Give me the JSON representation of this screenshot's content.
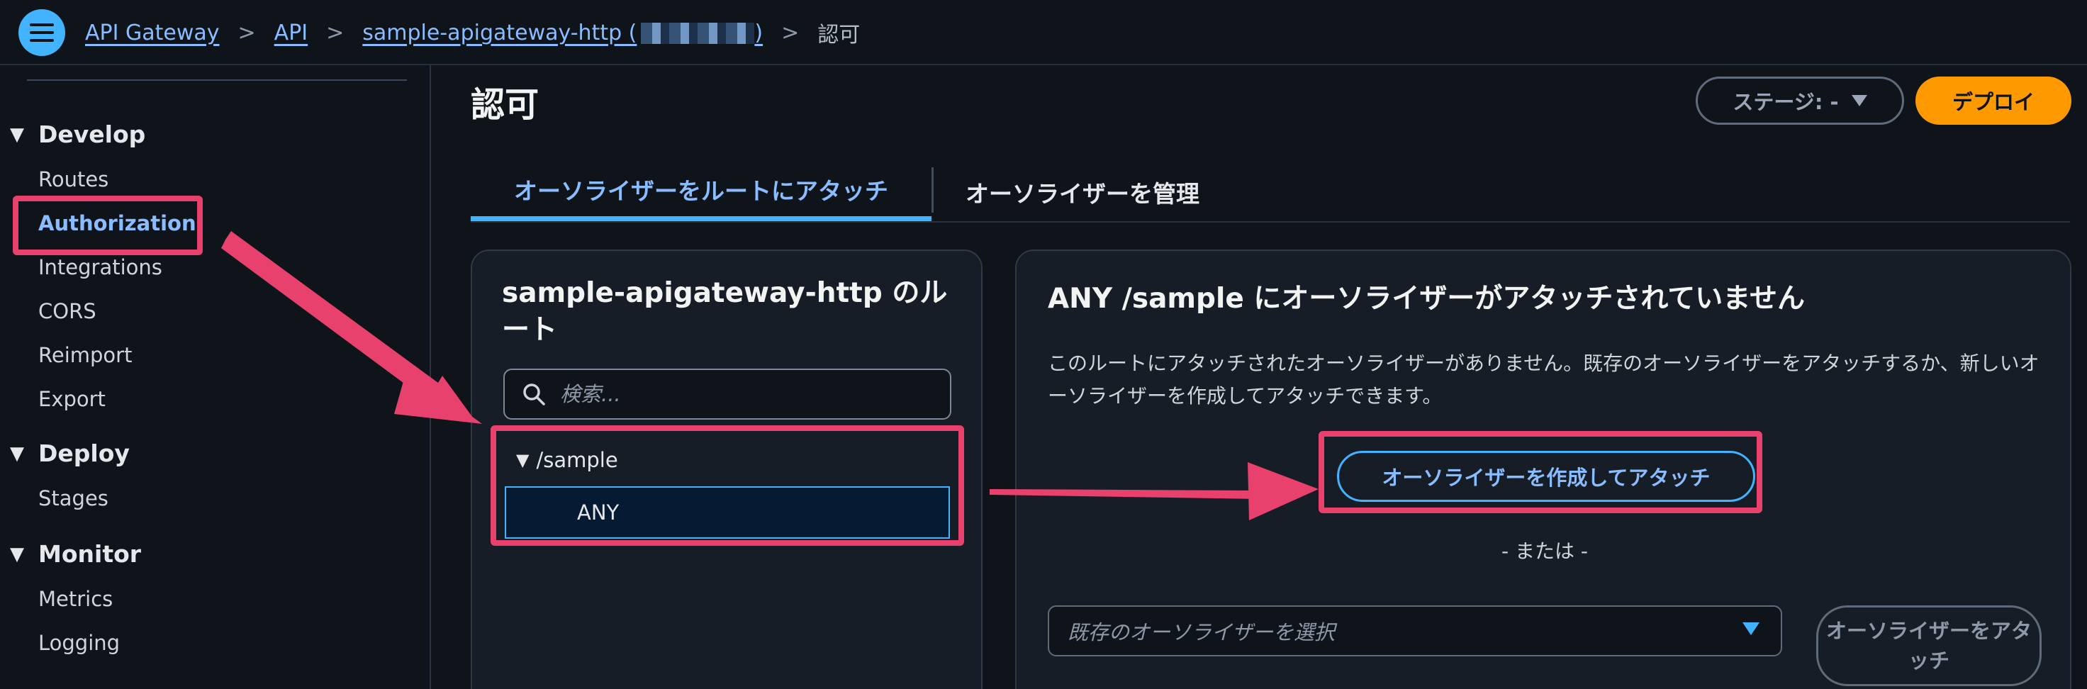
{
  "breadcrumb": {
    "items": [
      "API Gateway",
      "API",
      "sample-apigateway-http ("
    ],
    "tail": ")",
    "current": "認可"
  },
  "sidebar": {
    "sections": [
      {
        "label": "Develop",
        "items": [
          "Routes",
          "Authorization",
          "Integrations",
          "CORS",
          "Reimport",
          "Export"
        ]
      },
      {
        "label": "Deploy",
        "items": [
          "Stages"
        ]
      },
      {
        "label": "Monitor",
        "items": [
          "Metrics",
          "Logging"
        ]
      }
    ],
    "active_item": "Authorization"
  },
  "header": {
    "title": "認可",
    "stage_label": "ステージ: -",
    "deploy_label": "デプロイ"
  },
  "tabs": [
    {
      "label": "オーソライザーをルートにアタッチ",
      "active": true
    },
    {
      "label": "オーソライザーを管理",
      "active": false
    }
  ],
  "routes_panel": {
    "title": "sample-apigateway-http のルート",
    "search_placeholder": "検索...",
    "route_path": "/sample",
    "route_method": "ANY"
  },
  "detail_panel": {
    "title": "ANY /sample にオーソライザーがアタッチされていません",
    "description": "このルートにアタッチされたオーソライザーがありません。既存のオーソライザーをアタッチするか、新しいオーソライザーを作成してアタッチできます。",
    "create_button": "オーソライザーを作成してアタッチ",
    "or_text": "- または -",
    "select_placeholder": "既存のオーソライザーを選択",
    "attach_button": "オーソライザーをアタッチ"
  },
  "colors": {
    "accent": "#42b4ff",
    "link": "#89bdff",
    "deploy": "#ff9900",
    "highlight": "#e8416d",
    "background": "#0f141a"
  }
}
